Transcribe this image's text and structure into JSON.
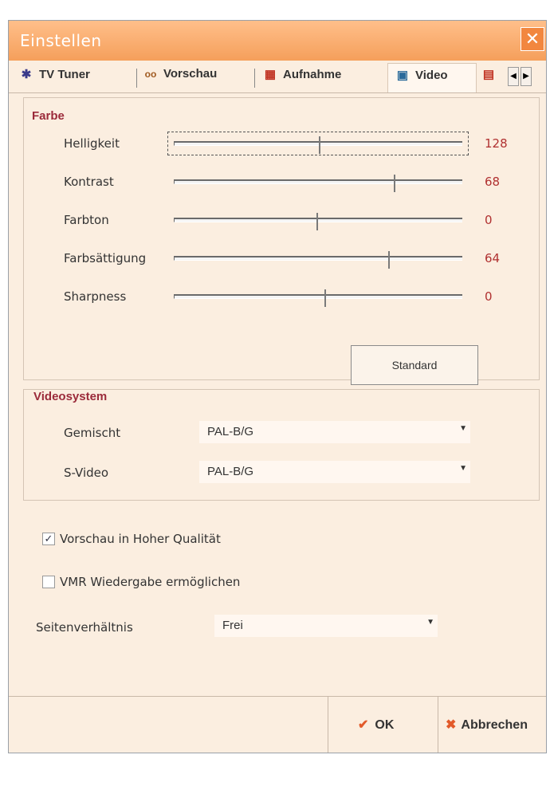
{
  "window": {
    "title": "Einstellen"
  },
  "tabs": [
    {
      "label": "TV Tuner",
      "icon": "satellite-icon"
    },
    {
      "label": "Vorschau",
      "icon": "glasses-icon"
    },
    {
      "label": "Aufnahme",
      "icon": "film-icon"
    },
    {
      "label": "Video",
      "icon": "monitor-icon"
    }
  ],
  "color_group": {
    "title": "Farbe",
    "sliders": [
      {
        "label": "Helligkeit",
        "value": "128",
        "position": 0.51
      },
      {
        "label": "Kontrast",
        "value": "68",
        "position": 0.77
      },
      {
        "label": "Farbton",
        "value": "0",
        "position": 0.5
      },
      {
        "label": "Farbsättigung",
        "value": "64",
        "position": 0.75
      },
      {
        "label": "Sharpness",
        "value": "0",
        "position": 0.53
      }
    ],
    "standard_button": "Standard"
  },
  "video_group": {
    "title": "Videosystem",
    "rows": [
      {
        "label": "Gemischt",
        "value": "PAL-B/G"
      },
      {
        "label": "S-Video",
        "value": "PAL-B/G"
      }
    ]
  },
  "options": {
    "preview_hq": {
      "label": "Vorschau in Hoher Qualität",
      "checked": true
    },
    "vmr": {
      "label": "VMR Wiedergabe ermöglichen",
      "checked": false
    },
    "aspect_label": "Seitenverhältnis",
    "aspect_value": "Frei"
  },
  "footer": {
    "ok": "OK",
    "cancel": "Abbrechen"
  },
  "colors": {
    "accent": "#f59f5b",
    "group_title": "#9b2a3a",
    "value": "#b03030"
  }
}
